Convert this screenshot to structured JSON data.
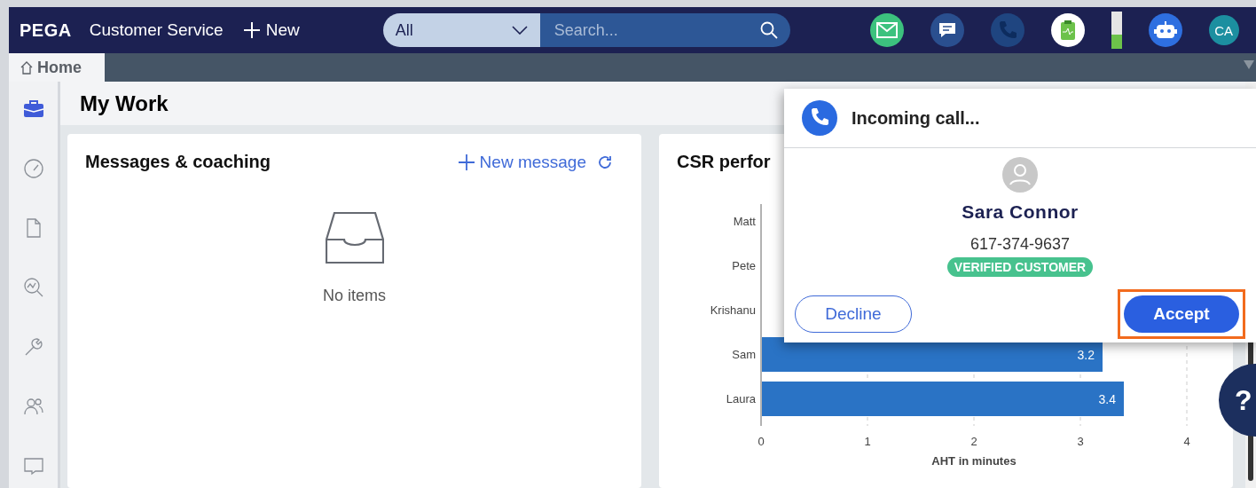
{
  "header": {
    "logo": "PEGA",
    "app_name": "Customer Service",
    "new_button": "New",
    "search_scope": "All",
    "search_placeholder": "Search...",
    "avatar_initials": "CA"
  },
  "tabs": [
    {
      "label": "Home",
      "selected": true
    }
  ],
  "sidebar": {
    "items": [
      {
        "kind": "briefcase",
        "selected": true
      },
      {
        "kind": "gauge",
        "selected": false
      },
      {
        "kind": "document",
        "selected": false
      },
      {
        "kind": "analytics",
        "selected": false
      },
      {
        "kind": "wrench",
        "selected": false
      },
      {
        "kind": "people",
        "selected": false
      },
      {
        "kind": "chat",
        "selected": false
      }
    ]
  },
  "page_title": "My Work",
  "messages_card": {
    "title": "Messages & coaching",
    "new_message": "New message",
    "empty_text": "No items"
  },
  "performance_card": {
    "title": "CSR perfor",
    "chart_data": {
      "type": "bar",
      "orientation": "horizontal",
      "xlabel": "AHT in minutes",
      "categories": [
        "Matt",
        "Pete",
        "Krishanu",
        "Sam",
        "Laura"
      ],
      "series": [
        {
          "color": "#2a73c5",
          "values": [
            null,
            null,
            null,
            3.2,
            3.4
          ]
        }
      ],
      "xlim": [
        0,
        4
      ],
      "xticks": [
        0,
        1,
        2,
        3,
        4
      ],
      "grid": true,
      "data_labels": true
    }
  },
  "incoming_call": {
    "title": "Incoming call...",
    "caller_name": "Sara Connor",
    "phone": "617-374-9637",
    "badge": "VERIFIED CUSTOMER",
    "decline": "Decline",
    "accept": "Accept"
  },
  "help": "?"
}
